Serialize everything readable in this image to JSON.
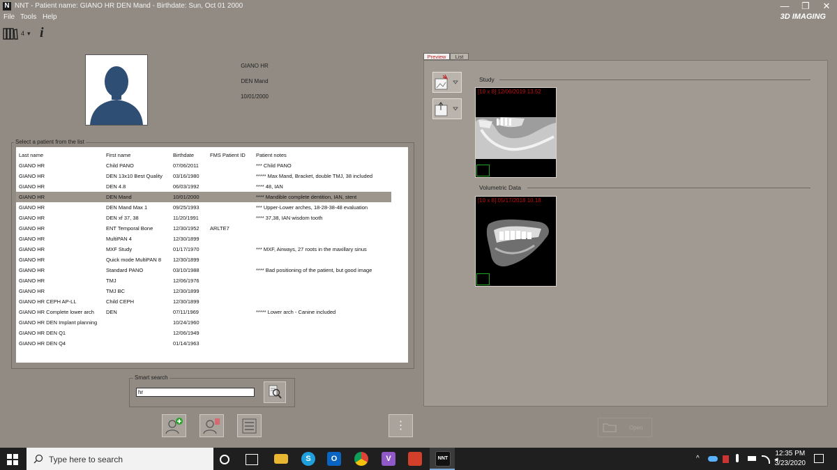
{
  "window": {
    "icon_letter": "N",
    "title": "NNT - Patient name: GIANO HR DEN Mand - Birthdate: Sun, Oct 01 2000",
    "minimize": "—",
    "restore": "❐",
    "close": "✕",
    "brand": "3D IMAGING"
  },
  "menu": {
    "file": "File",
    "tools": "Tools",
    "help": "Help"
  },
  "toolbar": {
    "library_count": "4",
    "dropdown_arrow": "▾",
    "info_glyph": "i"
  },
  "patient": {
    "last_name": "GIANO HR",
    "first_name": "DEN Mand",
    "birthdate": "10/01/2000"
  },
  "patient_list": {
    "legend": "Select a patient from the list",
    "columns": [
      "Last name",
      "First name",
      "Birthdate",
      "FMS Patient ID",
      "Patient notes"
    ],
    "selected_index": 3,
    "rows": [
      [
        "GIANO HR",
        "Child PANO",
        "07/06/2011",
        "",
        "*** Child PANO"
      ],
      [
        "GIANO HR",
        "DEN 13x10 Best Quality",
        "03/16/1980",
        "",
        "***** Max Mand, Bracket, double TMJ, 38 included"
      ],
      [
        "GIANO HR",
        "DEN 4.8",
        "06/03/1992",
        "",
        "**** 48, IAN"
      ],
      [
        "GIANO HR",
        "DEN Mand",
        "10/01/2000",
        "",
        "**** Mandible complete dentition, IAN, stent"
      ],
      [
        "GIANO HR",
        "DEN Mand Max 1",
        "09/25/1993",
        "",
        "*** Upper-Lower arches, 18-28-38-48 evaluation"
      ],
      [
        "GIANO HR",
        "DEN xf 37, 38",
        "11/20/1991",
        "",
        "**** 37,38, IAN wisdom tooth"
      ],
      [
        "GIANO HR",
        "ENT Temporal Bone",
        "12/30/1952",
        "ARLTE7",
        ""
      ],
      [
        "GIANO HR",
        "MultiPAN 4",
        "12/30/1899",
        "",
        ""
      ],
      [
        "GIANO HR",
        "MXF Study",
        "01/17/1970",
        "",
        "*** MXF, Airways, 27 roots in the maxillary sinus"
      ],
      [
        "GIANO HR",
        "Quick mode MultiPAN 8",
        "12/30/1899",
        "",
        ""
      ],
      [
        "GIANO HR",
        "Standard PANO",
        "03/10/1988",
        "",
        "**** Bad positioning of the patient, but good image"
      ],
      [
        "GIANO HR",
        "TMJ",
        "12/06/1976",
        "",
        ""
      ],
      [
        "GIANO HR",
        "TMJ BC",
        "12/30/1899",
        "",
        ""
      ],
      [
        "GIANO HR CEPH AP-LL",
        "Child CEPH",
        "12/30/1899",
        "",
        ""
      ],
      [
        "GIANO HR Complete lower arch",
        "DEN",
        "07/11/1969",
        "",
        "***** Lower arch - Canine included"
      ],
      [
        "GIANO HR DEN Implant planning",
        "",
        "10/24/1960",
        "",
        ""
      ],
      [
        "GIANO HR DEN Q1",
        "",
        "12/06/1949",
        "",
        ""
      ],
      [
        "GIANO HR DEN Q4",
        "",
        "01/14/1963",
        "",
        ""
      ]
    ]
  },
  "smart_search": {
    "legend": "Smart search",
    "value": "hr"
  },
  "right_panel": {
    "tabs": [
      "Preview",
      "List"
    ],
    "active_tab": "Preview",
    "study_title": "Study",
    "study_thumb_label": "[10 x 8]  12/06/2019 13.52",
    "volumetric_title": "Volumetric Data",
    "volumetric_thumb_label": "[10 x 8]  05/17/2018 10.18",
    "open_label": "Open",
    "more_glyph": "⋮"
  },
  "taskbar": {
    "search_placeholder": "Type here to search",
    "nnt_label": "NNT",
    "time": "12:35 PM",
    "date": "3/23/2020"
  },
  "colors": {
    "background": "#918b83",
    "panel": "#a09a92",
    "selection": "#9c968d",
    "thumb_label": "#c01010",
    "check_border": "#1ea81e"
  }
}
